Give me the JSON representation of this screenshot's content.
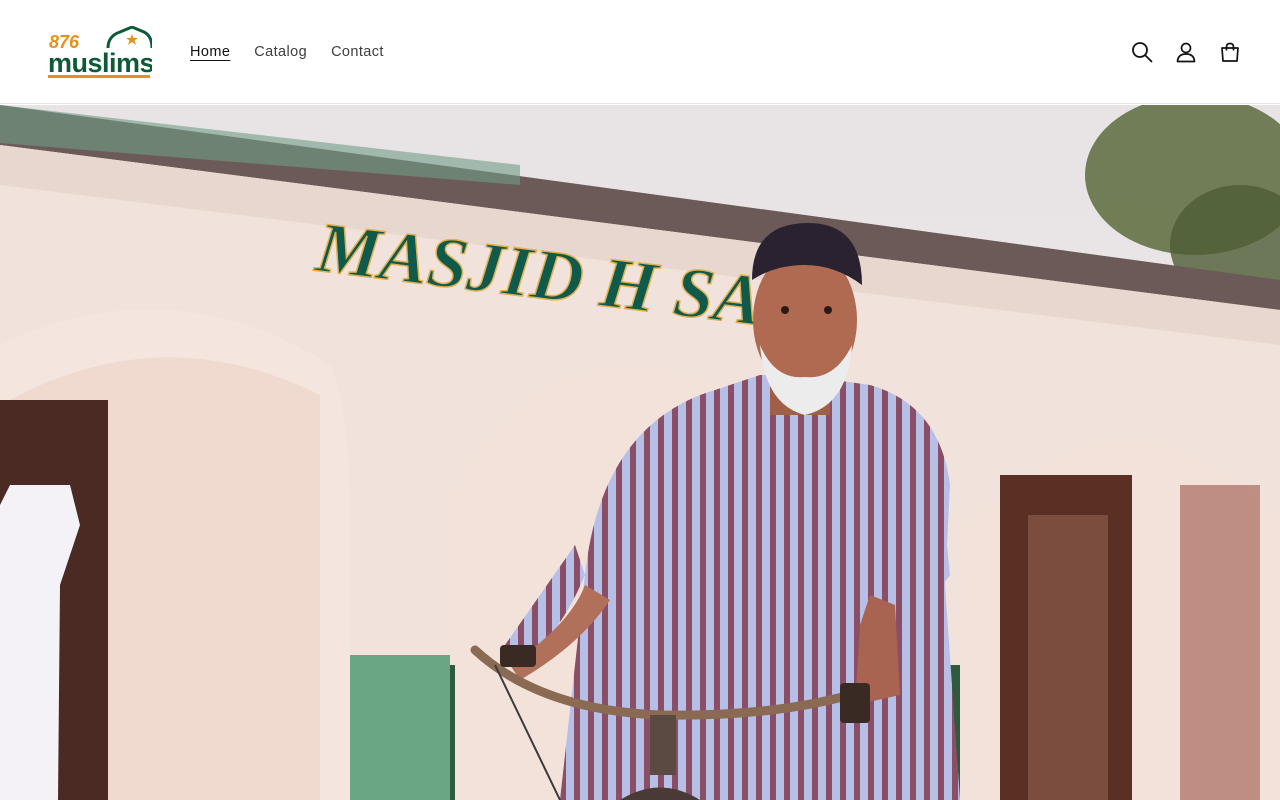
{
  "brand": {
    "number": "876",
    "name": "muslims",
    "logo_alt": "876 Muslims"
  },
  "nav": {
    "items": [
      {
        "label": "Home",
        "active": true
      },
      {
        "label": "Catalog",
        "active": false
      },
      {
        "label": "Contact",
        "active": false
      }
    ]
  },
  "header_icons": {
    "search": {
      "icon": "search-icon",
      "label": "Search"
    },
    "account": {
      "icon": "account-icon",
      "label": "Log in"
    },
    "cart": {
      "icon": "cart-icon",
      "label": "Cart"
    }
  },
  "hero": {
    "alt": "Elderly man with a bicycle in front of Masjid Hussain",
    "building_sign": "MASJID H   SAIN"
  },
  "colors": {
    "brand_green": "#0f5a36",
    "brand_orange": "#e8901c",
    "text": "#121212"
  }
}
